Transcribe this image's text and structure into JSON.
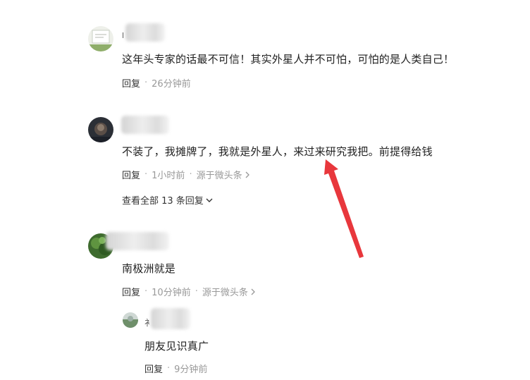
{
  "comments": [
    {
      "text": "这年头专家的话最不可信！其实外星人并不可怕，可怕的是人类自己！",
      "name_prefix": "l",
      "reply_label": "回复",
      "time": "26分钟前"
    },
    {
      "text": "不装了，我摊牌了，我就是外星人，来过来研究我把。前提得给钱",
      "name_prefix": "",
      "reply_label": "回复",
      "time": "1小时前",
      "source": "源于微头条",
      "view_all": "查看全部 13 条回复"
    },
    {
      "text": "南极洲就是",
      "reply_label": "回复",
      "time": "10分钟前",
      "source": "源于微头条",
      "sub_reply": {
        "name_prefix": "衤",
        "text": "朋友见识真广",
        "reply_label": "回复",
        "time": "9分钟前"
      }
    }
  ],
  "separator": "·",
  "annotation": {
    "color": "#e8373c"
  }
}
